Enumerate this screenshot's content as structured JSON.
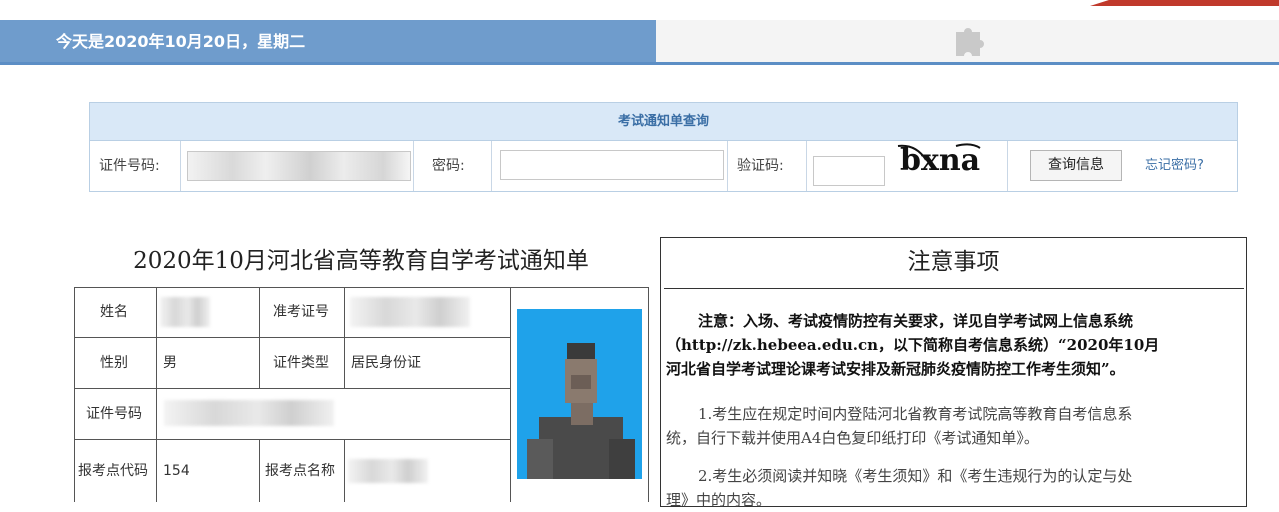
{
  "header": {
    "date_text": "今天是2020年10月20日，星期二"
  },
  "query": {
    "title": "考试通知单查询",
    "id_label": "证件号码:",
    "password_label": "密码:",
    "captcha_label": "验证码:",
    "captcha_text": "bxna",
    "submit_label": "查询信息",
    "forgot_label": "忘记密码?"
  },
  "notice": {
    "title": "2020年10月河北省高等教育自学考试通知单",
    "rows": {
      "name_label": "姓名",
      "ticket_label": "准考证号",
      "gender_label": "性别",
      "gender_value": "男",
      "idtype_label": "证件类型",
      "idtype_value": "居民身份证",
      "idnum_label": "证件号码",
      "site_code_label": "报考点代码",
      "site_code_value": "154",
      "site_name_label": "报考点名称"
    }
  },
  "notes": {
    "title": "注意事项",
    "para1_line1": "注意：入场、考试疫情防控有关要求，详见自学考试网上信息系统",
    "para1_line2": "（http://zk.hebeea.edu.cn，以下简称自考信息系统）“2020年10月",
    "para1_line3": "河北省自学考试理论课考试安排及新冠肺炎疫情防控工作考生须知”。",
    "item1_line1": "1.考生应在规定时间内登陆河北省教育考试院高等教育自考信息系",
    "item1_line2": "统，自行下载并使用A4白色复印纸打印《考试通知单》。",
    "item2_line1": "2.考生必须阅读并知晓《考生须知》和《考生违规行为的认定与处",
    "item2_line2": "理》中的内容。"
  },
  "icons": {
    "puzzle": "puzzle-icon",
    "captcha": "captcha-image",
    "photo": "candidate-photo"
  },
  "colors": {
    "header_bar": "#6f9ccc",
    "header_line": "#5c8ec5",
    "query_head": "#d9e8f7",
    "link": "#3b6fa6",
    "photo_bg": "#1fa2ea"
  }
}
